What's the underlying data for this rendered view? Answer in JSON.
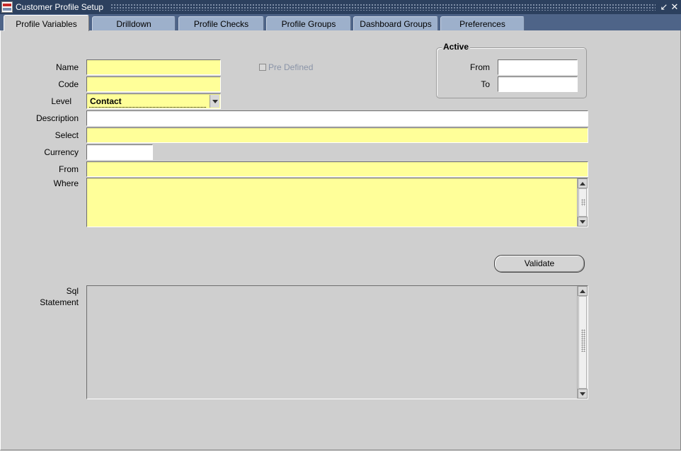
{
  "window": {
    "title": "Customer Profile Setup",
    "minimize_glyph": "↙",
    "close_glyph": "✕",
    "icon": "oracle-app-icon"
  },
  "tabs": [
    {
      "label": "Profile Variables",
      "active": true
    },
    {
      "label": "Drilldown",
      "active": false
    },
    {
      "label": "Profile Checks",
      "active": false
    },
    {
      "label": "Profile Groups",
      "active": false
    },
    {
      "label": "Dashboard Groups",
      "active": false
    },
    {
      "label": "Preferences",
      "active": false
    }
  ],
  "form": {
    "name": {
      "label": "Name",
      "value": ""
    },
    "code": {
      "label": "Code",
      "value": ""
    },
    "level": {
      "label": "Level",
      "value": "Contact"
    },
    "predefined": {
      "label": "Pre Defined",
      "checked": false,
      "enabled": false
    },
    "active": {
      "title": "Active",
      "from": {
        "label": "From",
        "value": ""
      },
      "to": {
        "label": "To",
        "value": ""
      }
    },
    "description": {
      "label": "Description",
      "value": ""
    },
    "select": {
      "label": "Select",
      "value": ""
    },
    "currency": {
      "label": "Currency",
      "value": ""
    },
    "from": {
      "label": "From",
      "value": ""
    },
    "where": {
      "label": "Where",
      "value": ""
    },
    "validate_button": "Validate",
    "sql_statement": {
      "label_line1": "Sql",
      "label_line2": "Statement",
      "value": ""
    }
  },
  "colors": {
    "required_field": "#ffff99",
    "canvas": "#cfcfcf",
    "titlebar": "#2c405e",
    "tabstrip": "#4e6488",
    "inactive_tab": "#9db0cb"
  }
}
